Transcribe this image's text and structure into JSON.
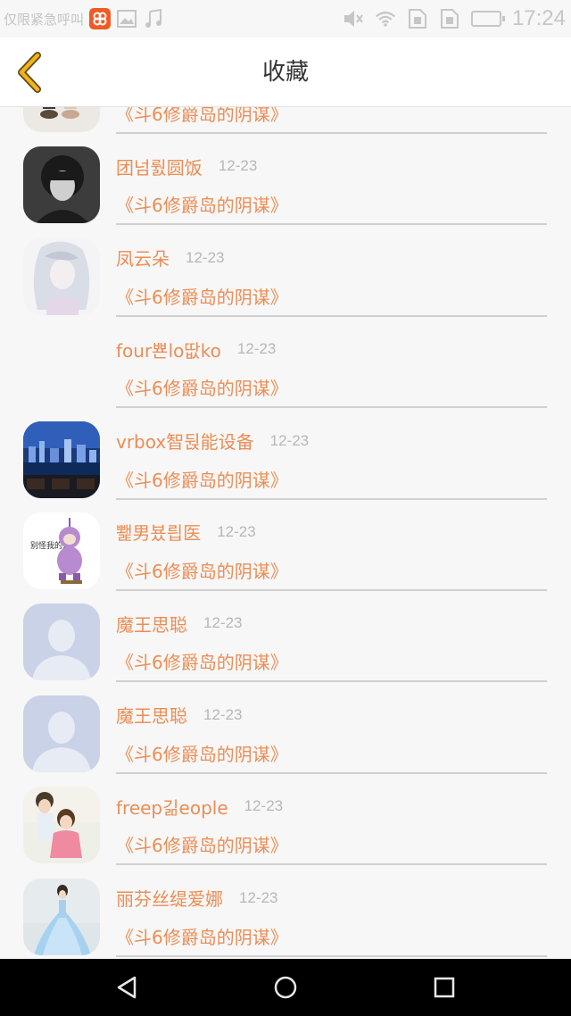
{
  "status_bar": {
    "carrier": "仅限紧急呼叫",
    "app_badge": "",
    "time": "17:24"
  },
  "header": {
    "title": "收藏"
  },
  "items": [
    {
      "name": "",
      "date": "",
      "book": "《斗6修爵岛的阴谋》",
      "avatar": "photo-legs"
    },
    {
      "name": "团넘뤐圆饭",
      "date": "12-23",
      "book": "《斗6修爵岛的阴谋》",
      "avatar": "photo-man"
    },
    {
      "name": "凤云朵",
      "date": "12-23",
      "book": "《斗6修爵岛的阴谋》",
      "avatar": "anime-girl"
    },
    {
      "name": "four뾴lo땂ko",
      "date": "12-23",
      "book": "《斗6修爵岛的阴谋》",
      "avatar": "none"
    },
    {
      "name": "vrbox智뒩能设备",
      "date": "12-23",
      "book": "《斗6修爵岛的阴谋》",
      "avatar": "city-night"
    },
    {
      "name": "뾅男뵸릡医",
      "date": "12-23",
      "book": "《斗6修爵岛的阴谋》",
      "avatar": "cartoon-teletubby"
    },
    {
      "name": "魔王思聪",
      "date": "12-23",
      "book": "《斗6修爵岛的阴谋》",
      "avatar": "default-user"
    },
    {
      "name": "魔王思聪",
      "date": "12-23",
      "book": "《斗6修爵岛的阴谋》",
      "avatar": "default-user"
    },
    {
      "name": "freep긺eople",
      "date": "12-23",
      "book": "《斗6修爵岛的阴谋》",
      "avatar": "photo-child"
    },
    {
      "name": "丽芬丝缇爱娜",
      "date": "12-23",
      "book": "《斗6修爵岛的阴谋》",
      "avatar": "photo-dress"
    }
  ],
  "colors": {
    "accent": "#ec8d55",
    "back_arrow": "#f2b31a",
    "date": "#b7b7b7"
  }
}
